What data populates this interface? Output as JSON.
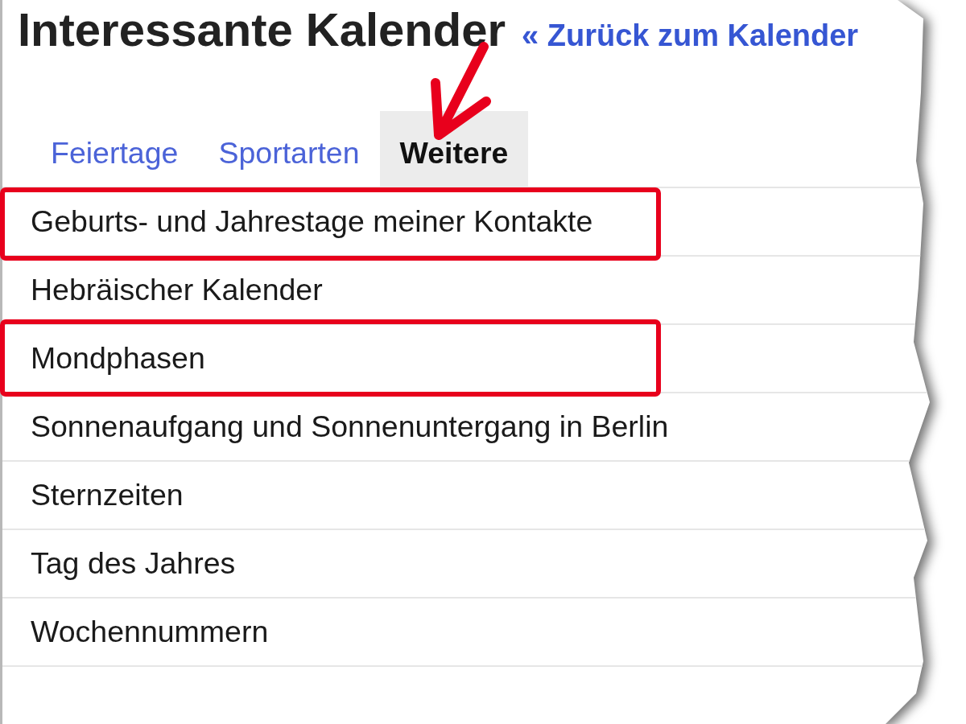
{
  "header": {
    "title": "Interessante Kalender",
    "back_link": "« Zurück zum Kalender"
  },
  "tabs": [
    {
      "label": "Feiertage",
      "selected": false,
      "pointed_at": false
    },
    {
      "label": "Sportarten",
      "selected": false,
      "pointed_at": false
    },
    {
      "label": "Weitere",
      "selected": true,
      "pointed_at": true
    }
  ],
  "calendars": [
    {
      "name": "Geburts- und Jahrestage meiner Kontakte",
      "highlighted": true
    },
    {
      "name": "Hebräischer Kalender",
      "highlighted": false
    },
    {
      "name": "Mondphasen",
      "highlighted": true
    },
    {
      "name": "Sonnenaufgang und Sonnenuntergang in Berlin",
      "highlighted": false
    },
    {
      "name": "Sternzeiten",
      "highlighted": false
    },
    {
      "name": "Tag des Jahres",
      "highlighted": false
    },
    {
      "name": "Wochennummern",
      "highlighted": false
    }
  ]
}
